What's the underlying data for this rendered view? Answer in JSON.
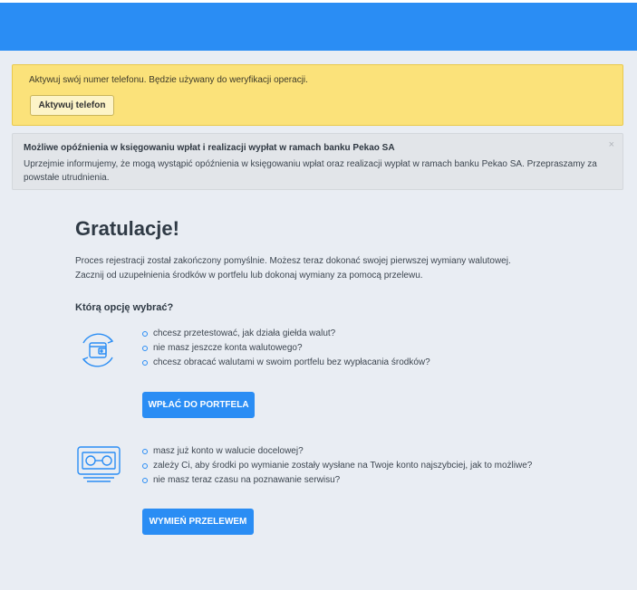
{
  "alert_phone": {
    "message": "Aktywuj swój numer telefonu. Będzie używany do weryfikacji operacji.",
    "button_label": "Aktywuj telefon"
  },
  "alert_info": {
    "title": "Możliwe opóźnienia w księgowaniu wpłat i realizacji wypłat w ramach banku Pekao SA",
    "body": "Uprzejmie informujemy, że mogą wystąpić opóźnienia w księgowaniu wpłat oraz realizacji wypłat w ramach banku Pekao SA. Przepraszamy za powstałe utrudnienia.",
    "close_glyph": "×"
  },
  "main": {
    "heading": "Gratulacje!",
    "intro_line1": "Proces rejestracji został zakończony pomyślnie. Możesz teraz dokonać swojej pierwszej wymiany walutowej.",
    "intro_line2": "Zacznij od uzupełnienia środków w portfelu lub dokonaj wymiany za pomocą przelewu.",
    "subheading": "Którą opcję wybrać?"
  },
  "option_wallet": {
    "icon": "wallet-exchange-icon",
    "items": [
      "chcesz przetestować, jak działa giełda walut?",
      "nie masz jeszcze konta walutowego?",
      "chcesz obracać walutami w swoim portfelu bez wypłacania środków?"
    ],
    "button_label": "WPŁAĆ DO PORTFELA"
  },
  "option_transfer": {
    "icon": "banknote-transfer-icon",
    "items": [
      "masz już konto w walucie docelowej?",
      "zależy Ci, aby środki po wymianie zostały wysłane na Twoje konto najszybciej, jak to możliwe?",
      "nie masz teraz czasu na poznawanie serwisu?"
    ],
    "button_label": "WYMIEŃ PRZELEWEM"
  },
  "colors": {
    "accent": "#2a8df4",
    "warning_bg": "#fbe27a",
    "info_bg": "#e2e5e9",
    "page_bg": "#e9edf3"
  }
}
